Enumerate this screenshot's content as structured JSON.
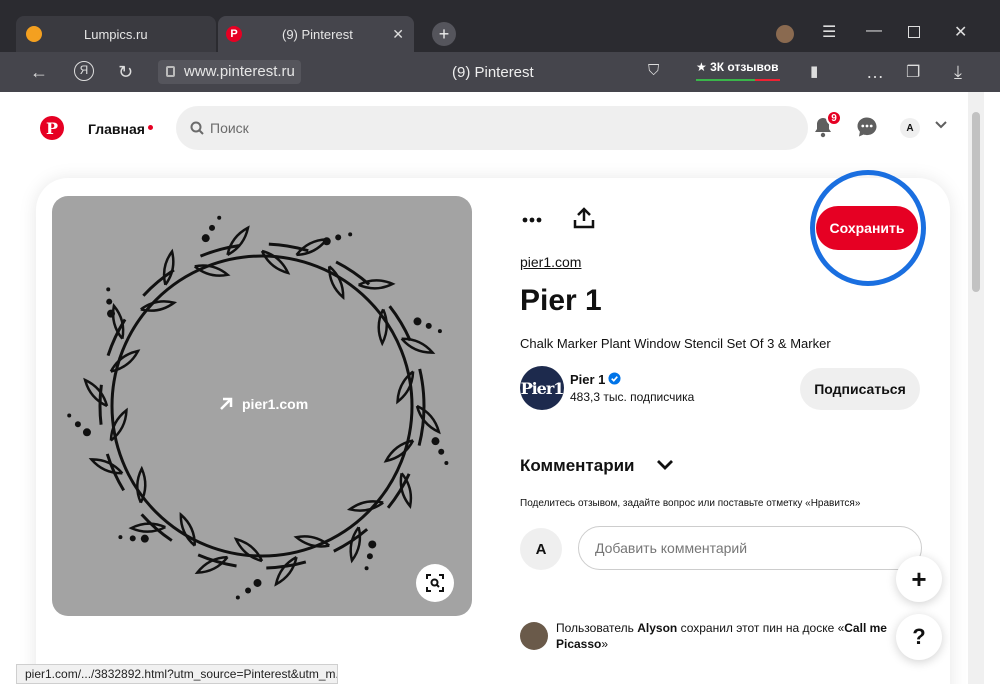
{
  "browser": {
    "tabs": [
      {
        "title": "Lumpics.ru"
      },
      {
        "title": "(9) Pinterest"
      }
    ],
    "address": "www.pinterest.ru",
    "page_title": "(9) Pinterest",
    "reviews_label": "★ 3К отзывов",
    "status_url": "pier1.com/.../3832892.html?utm_source=Pinterest&utm_m..."
  },
  "header": {
    "home_label": "Главная",
    "search_placeholder": "Поиск",
    "notifications_count": "9",
    "account_initial": "A"
  },
  "pin": {
    "image_link_text": "pier1.com",
    "source_link": "pier1.com",
    "save_label": "Сохранить",
    "title": "Pier 1",
    "description": "Chalk Marker Plant Window Stencil Set Of 3 & Marker",
    "brand_logo_text": "Pier1",
    "brand_name": "Pier 1",
    "followers": "483,3 тыс. подписчика",
    "follow_label": "Подписаться"
  },
  "comments": {
    "heading": "Комментарии",
    "hint": "Поделитесь отзывом, задайте вопрос или поставьте отметку «Нравится»",
    "avatar_initial": "A",
    "input_placeholder": "Добавить комментарий"
  },
  "activity": {
    "prefix": "Пользователь ",
    "user": "Alyson",
    "middle": " сохранил этот пин на доске «",
    "board": "Call me Picasso",
    "suffix": "»"
  },
  "fabs": {
    "plus": "+",
    "help": "?"
  },
  "colors": {
    "brand_red": "#e60023",
    "highlight_ring": "#1a6fe0",
    "chrome_dark": "#2b2b30"
  }
}
